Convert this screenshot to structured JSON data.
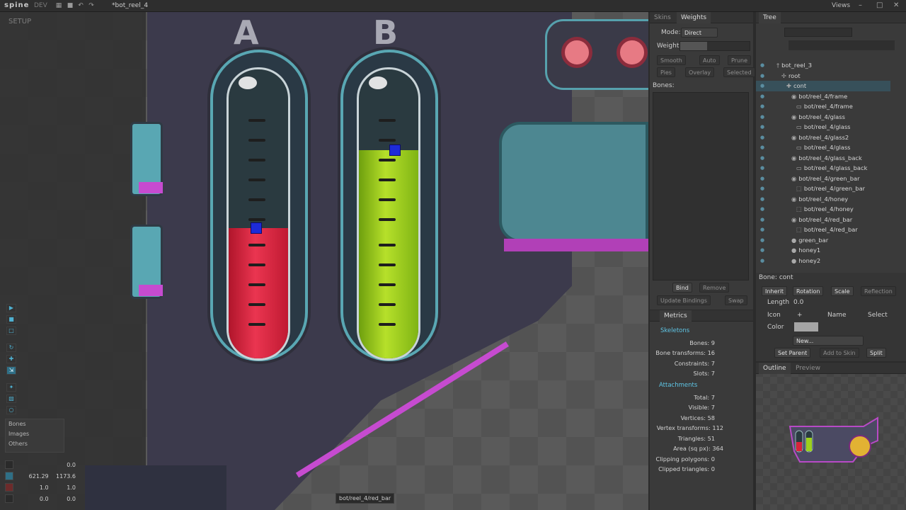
{
  "app": {
    "logo": "spine",
    "edition": "DEV",
    "file_name": "*bot_reel_4",
    "views_label": "Views"
  },
  "viewport": {
    "mode_label": "SETUP",
    "label_a": "A",
    "label_b": "B",
    "status_tip": "bot/reel_4/red_bar",
    "visibility": {
      "bones": "Bones",
      "images": "Images",
      "others": "Others"
    },
    "coords": [
      {
        "a": "",
        "b": "0.0"
      },
      {
        "a": "621.29",
        "b": "1173.6"
      },
      {
        "a": "1.0",
        "b": "1.0"
      },
      {
        "a": "0.0",
        "b": "0.0"
      }
    ],
    "tube_a_level": 0.45,
    "tube_b_level": 0.72
  },
  "weights": {
    "tabs": [
      "Skins",
      "Weights"
    ],
    "mode_label": "Mode:",
    "mode_value": "Direct",
    "weight_label": "Weight:",
    "buttons_row1": [
      "Smooth",
      "Auto",
      "Prune"
    ],
    "buttons_row2": [
      "Pies",
      "Overlay",
      "Selected"
    ],
    "bones_label": "Bones:",
    "bind": "Bind",
    "remove": "Remove",
    "update_bindings": "Update Bindings",
    "swap": "Swap"
  },
  "metrics": {
    "tab": "Metrics",
    "skeletons_head": "Skeletons",
    "skeletons": [
      "Bones: 9",
      "Bone transforms: 16",
      "Constraints: 7",
      "Slots: 7"
    ],
    "attachments_head": "Attachments",
    "attachments": [
      "Total: 7",
      "Visible: 7",
      "Vertices: 58",
      "Vertex transforms: 112",
      "Triangles: 51",
      "Area (sq px): 364",
      "Clipping polygons: 0",
      "Clipped triangles: 0"
    ]
  },
  "tree": {
    "tab": "Tree",
    "rows": [
      {
        "name": "bot_reel_3",
        "glyph": "†",
        "indent": 1
      },
      {
        "name": "root",
        "glyph": "✢",
        "indent": 2
      },
      {
        "name": "cont",
        "glyph": "✚",
        "indent": 3,
        "selected": true
      },
      {
        "name": "bot/reel_4/frame",
        "glyph": "◉",
        "indent": 4
      },
      {
        "name": "bot/reel_4/frame",
        "glyph": "▭",
        "indent": 5
      },
      {
        "name": "bot/reel_4/glass",
        "glyph": "◉",
        "indent": 4
      },
      {
        "name": "bot/reel_4/glass",
        "glyph": "▭",
        "indent": 5
      },
      {
        "name": "bot/reel_4/glass2",
        "glyph": "◉",
        "indent": 4
      },
      {
        "name": "bot/reel_4/glass",
        "glyph": "▭",
        "indent": 5
      },
      {
        "name": "bot/reel_4/glass_back",
        "glyph": "◉",
        "indent": 4
      },
      {
        "name": "bot/reel_4/glass_back",
        "glyph": "▭",
        "indent": 5
      },
      {
        "name": "bot/reel_4/green_bar",
        "glyph": "◉",
        "indent": 4
      },
      {
        "name": "bot/reel_4/green_bar",
        "glyph": "⬚",
        "indent": 5
      },
      {
        "name": "bot/reel_4/honey",
        "glyph": "◉",
        "indent": 4
      },
      {
        "name": "bot/reel_4/honey",
        "glyph": "⬚",
        "indent": 5
      },
      {
        "name": "bot/reel_4/red_bar",
        "glyph": "◉",
        "indent": 4
      },
      {
        "name": "bot/reel_4/red_bar",
        "glyph": "⬚",
        "indent": 5
      },
      {
        "name": "green_bar",
        "glyph": "●",
        "indent": 4
      },
      {
        "name": "honey1",
        "glyph": "●",
        "indent": 4
      },
      {
        "name": "honey2",
        "glyph": "●",
        "indent": 4
      }
    ]
  },
  "bone": {
    "title": "Bone: cont",
    "inherit": "Inherit",
    "rotation": "Rotation",
    "scale": "Scale",
    "reflection": "Reflection",
    "length_label": "Length",
    "length_value": "0.0",
    "icon_label": "Icon",
    "icon_plus": "+",
    "name_label": "Name",
    "select_label": "Select",
    "color_label": "Color",
    "new_button": "New...",
    "set_parent": "Set Parent",
    "add_to_skin": "Add to Skin",
    "split": "Split"
  },
  "outline": {
    "tabs": [
      "Outline",
      "Preview"
    ]
  },
  "colors": {
    "accent": "#5fc6e6",
    "selection": "#37505a",
    "tube_red": "#d8233b",
    "tube_green": "#9dd11c",
    "magenta": "#c64bd0"
  }
}
